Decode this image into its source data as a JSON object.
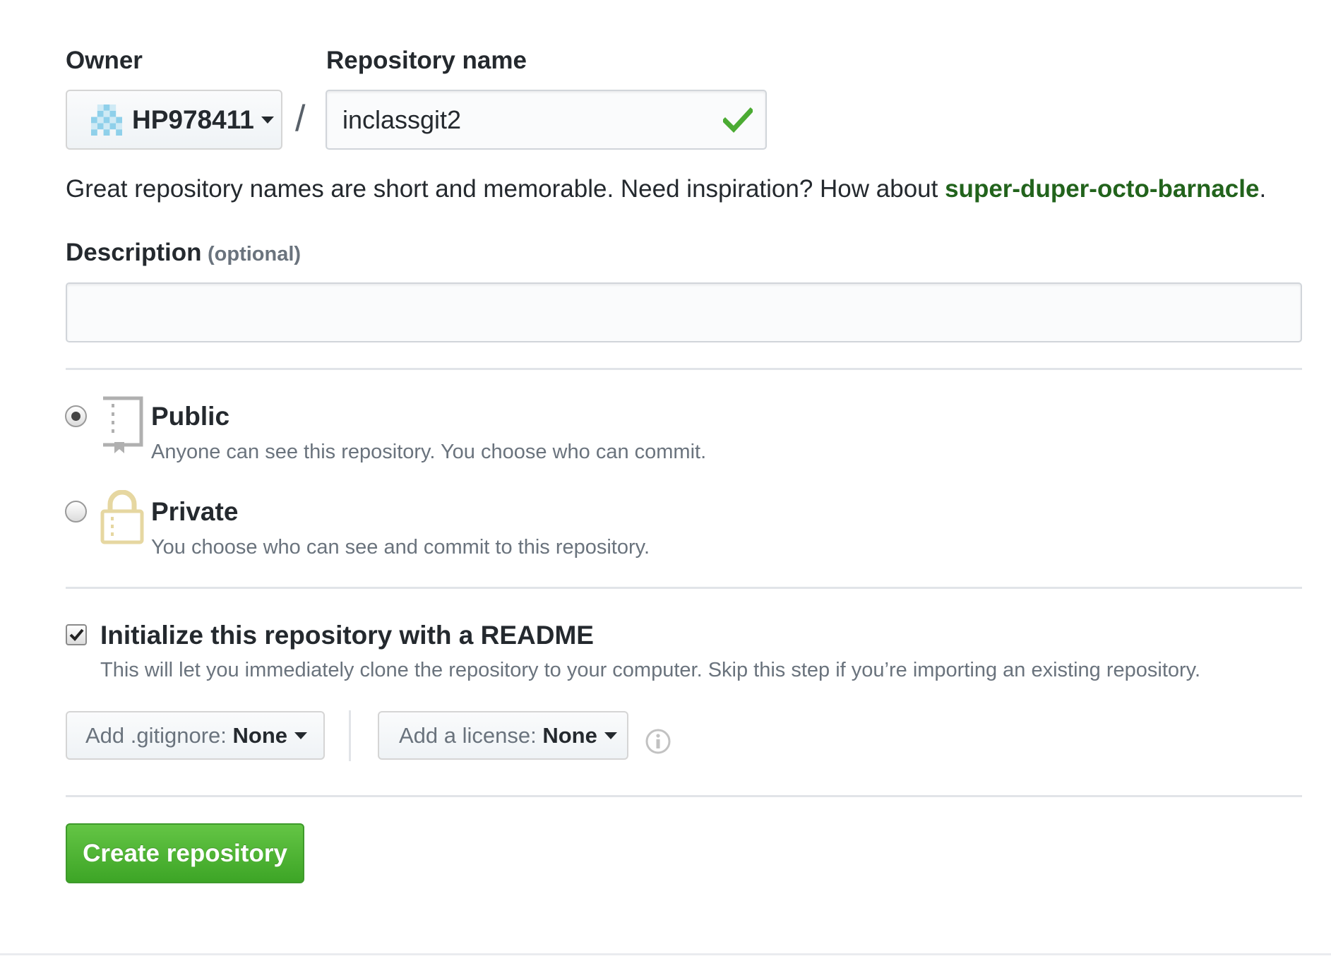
{
  "owner": {
    "label": "Owner",
    "value": "HP978411"
  },
  "separator": "/",
  "repo_name": {
    "label": "Repository name",
    "value": "inclassgit2"
  },
  "hint": {
    "text": "Great repository names are short and memorable. Need inspiration? How about ",
    "suggestion": "super-duper-octo-barnacle",
    "end": "."
  },
  "description": {
    "label": "Description",
    "optional": "(optional)",
    "value": ""
  },
  "visibility": {
    "public": {
      "title": "Public",
      "note": "Anyone can see this repository. You choose who can commit.",
      "selected": true
    },
    "private": {
      "title": "Private",
      "note": "You choose who can see and commit to this repository.",
      "selected": false
    }
  },
  "readme": {
    "label": "Initialize this repository with a README",
    "note": "This will let you immediately clone the repository to your computer. Skip this step if you’re importing an existing repository.",
    "checked": true
  },
  "gitignore": {
    "key": "Add .gitignore:",
    "value": "None"
  },
  "license": {
    "key": "Add a license:",
    "value": "None"
  },
  "create_button": "Create repository",
  "colors": {
    "accent_green": "#28a745",
    "link_green": "#22631c",
    "check_green": "#4bab33",
    "lock_yellow": "#e6d7a1"
  },
  "icons": [
    "identicon",
    "chevron-down-icon",
    "check-icon",
    "repo-icon",
    "lock-icon",
    "info-icon"
  ]
}
